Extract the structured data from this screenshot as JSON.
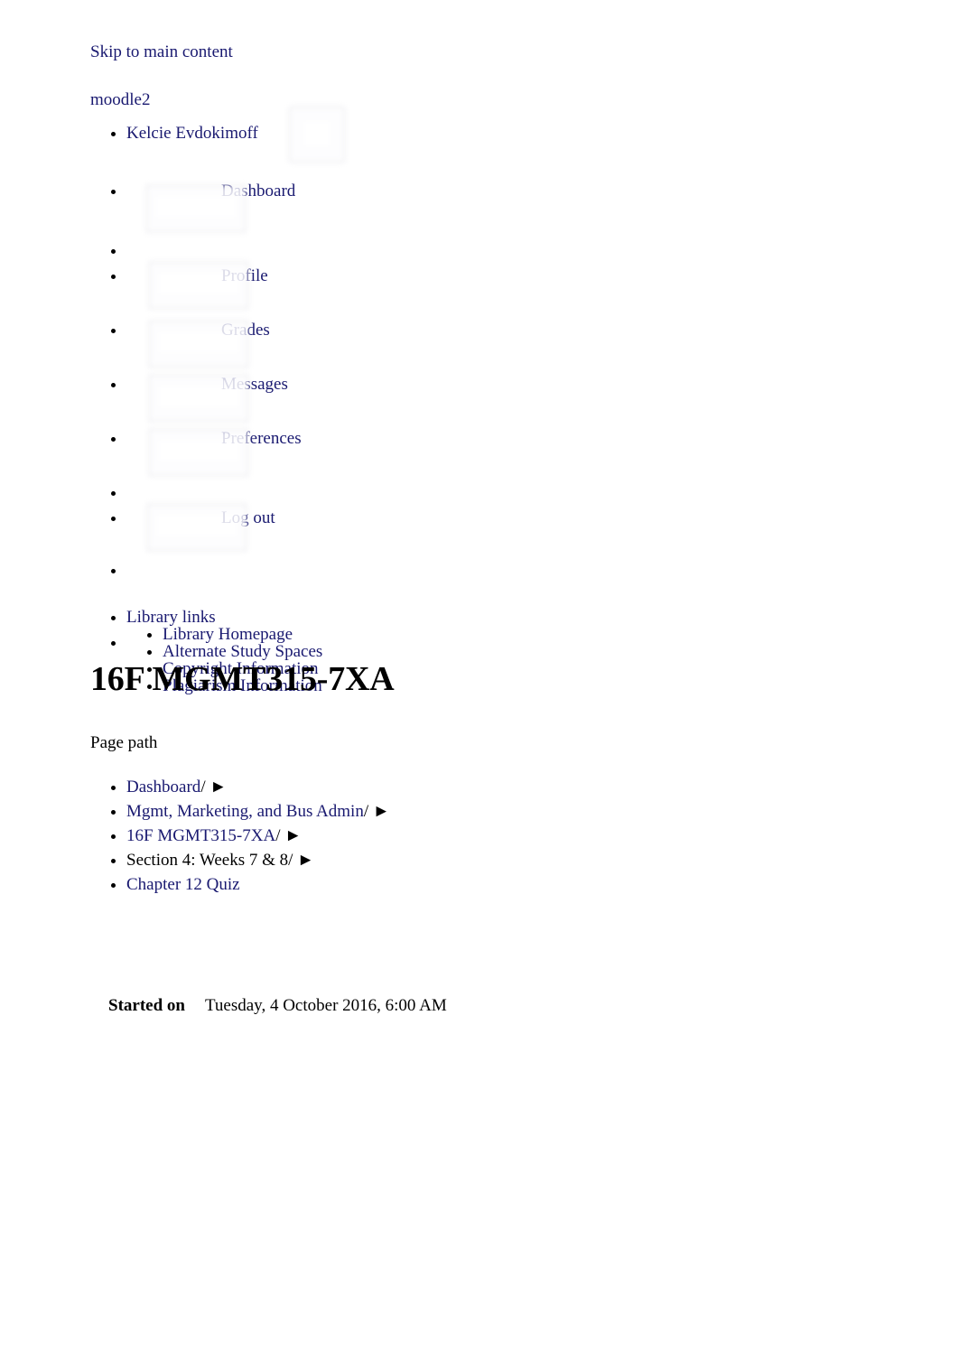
{
  "accessibility": {
    "skip_link": "Skip to main content"
  },
  "site": {
    "name": "moodle2"
  },
  "user_menu": {
    "user_name": "Kelcie Evdokimoff",
    "items": [
      {
        "label": "Dashboard",
        "icon": "broken-image-placeholder"
      },
      {
        "label": "Profile",
        "icon": "broken-image-placeholder"
      },
      {
        "label": "Grades",
        "icon": "broken-image-placeholder"
      },
      {
        "label": "Messages",
        "icon": "broken-image-placeholder"
      },
      {
        "label": "Preferences",
        "icon": "broken-image-placeholder"
      },
      {
        "label": "Log out",
        "icon": "broken-image-placeholder"
      }
    ]
  },
  "library_menu": {
    "label": "Library links",
    "items": [
      "Library Homepage",
      "Alternate Study Spaces",
      "Copyright Information",
      "Plagiarism Information"
    ]
  },
  "header": {
    "course_title": "16F MGMT315-7XA"
  },
  "page_path": {
    "label": "Page path",
    "separator": "/",
    "arrow": "►",
    "items": [
      {
        "text": "Dashboard",
        "is_link": true,
        "has_separator": true
      },
      {
        "text": "Mgmt, Marketing, and Bus Admin",
        "is_link": true,
        "has_separator": true
      },
      {
        "text": "16F MGMT315-7XA",
        "is_link": true,
        "has_separator": true
      },
      {
        "text": "Section 4: Weeks 7 & 8",
        "is_link": false,
        "has_separator": true
      },
      {
        "text": "Chapter 12 Quiz",
        "is_link": true,
        "has_separator": false
      }
    ]
  },
  "quiz_attempt": {
    "started_on_label": "Started on",
    "started_on_value": "Tuesday, 4 October 2016, 6:00 AM"
  },
  "colors": {
    "link": "#191970",
    "text": "#000000",
    "background": "#ffffff",
    "placeholder_border": "#d8d8de"
  }
}
